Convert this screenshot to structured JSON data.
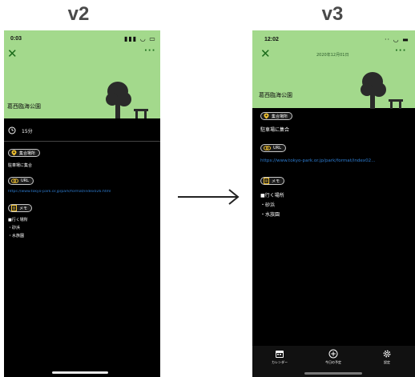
{
  "labels": {
    "v2": "v2",
    "v3": "v3"
  },
  "v2": {
    "time": "0:03",
    "place_name": "葛西臨海公園",
    "duration": "15分",
    "meeting_label": "集合場所",
    "meeting_text": "駐車場に集合",
    "url_label": "URL",
    "url_value": "https://www.tokyo-park.or.jp/park/format/index026.html",
    "memo_label": "メモ",
    "memo_lines": [
      "■行く場所",
      "・砂浜",
      "・水族園"
    ]
  },
  "v3": {
    "time": "12:02",
    "date": "2020年12月01日",
    "place_name": "葛西臨海公園",
    "meeting_label": "集合場所",
    "meeting_text": "駐車場に集合",
    "url_label": "URL",
    "url_value": "https://www.tokyo-park.or.jp/park/format/index02...",
    "memo_label": "メモ",
    "memo_lines": [
      "■行く場所",
      "・砂浜",
      "・水族園"
    ],
    "tabs": [
      {
        "label": "カレンダー",
        "icon": "calendar-icon"
      },
      {
        "label": "今日の予定",
        "icon": "plus-circle-icon"
      },
      {
        "label": "設定",
        "icon": "gear-icon"
      }
    ]
  },
  "colors": {
    "header_green": "#a3d98c",
    "link_blue": "#2d7dd2",
    "accent_green": "#1a6b1a"
  }
}
